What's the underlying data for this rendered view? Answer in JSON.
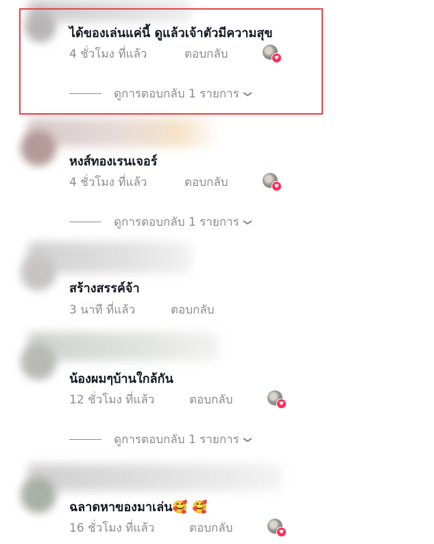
{
  "comments": [
    {
      "text": "ได้ของเล่นแค่นี้ ดูแล้วเจ้าตัวมีความสุข",
      "time": "4 ชั่วโมง ที่แล้ว",
      "reply_label": "ตอบกลับ",
      "liked_by_creator": true,
      "view_replies": "ดูการตอบกลับ 1 รายการ",
      "highlighted": true
    },
    {
      "text": "หงส์ทองเรนเจอร์",
      "time": "4 ชั่วโมง ที่แล้ว",
      "reply_label": "ตอบกลับ",
      "liked_by_creator": true,
      "view_replies": "ดูการตอบกลับ 1 รายการ"
    },
    {
      "text": "สร้างสรรค์จ้า",
      "time": "3 นาที ที่แล้ว",
      "reply_label": "ตอบกลับ",
      "liked_by_creator": false
    },
    {
      "text": "น้องผมๆบ้านใกล้กัน",
      "time": "12 ชั่วโมง ที่แล้ว",
      "reply_label": "ตอบกลับ",
      "liked_by_creator": true,
      "view_replies": "ดูการตอบกลับ 1 รายการ"
    },
    {
      "text": "ฉลาดหาของมาเล่น🥰 🥰",
      "time": "16 ชั่วโมง ที่แล้ว",
      "reply_label": "ตอบกลับ",
      "liked_by_creator": true
    }
  ],
  "icons": {
    "chevron": "chevron-down-icon",
    "heart": "heart-icon"
  },
  "colors": {
    "highlight_border": "#e0474d",
    "heart": "#fe2c55",
    "meta_text": "#8a8b91"
  }
}
